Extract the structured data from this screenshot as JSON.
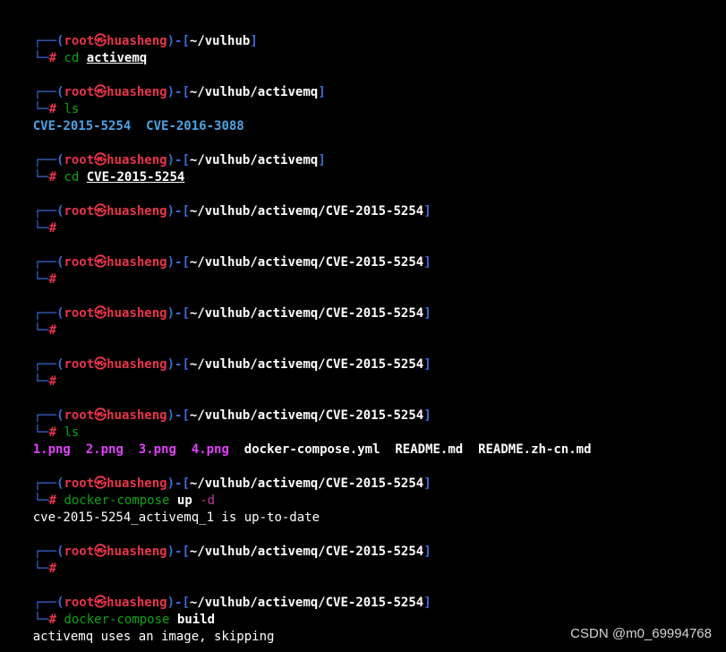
{
  "prompt": {
    "top_frame": "┌──(",
    "user": "root㉿huasheng",
    "mid_frame": ")-[",
    "end_frame": "]",
    "bottom_frame": "└─",
    "hash": "#"
  },
  "blocks": [
    {
      "path": "~/vulhub",
      "cmd": "cd",
      "arg": "activemq"
    },
    {
      "path": "~/vulhub/activemq",
      "cmd": "ls"
    },
    {
      "path": "~/vulhub/activemq",
      "cmd": "cd",
      "arg": "CVE-2015-5254"
    },
    {
      "path": "~/vulhub/activemq/CVE-2015-5254"
    },
    {
      "path": "~/vulhub/activemq/CVE-2015-5254"
    },
    {
      "path": "~/vulhub/activemq/CVE-2015-5254"
    },
    {
      "path": "~/vulhub/activemq/CVE-2015-5254"
    },
    {
      "path": "~/vulhub/activemq/CVE-2015-5254",
      "cmd": "ls"
    },
    {
      "path": "~/vulhub/activemq/CVE-2015-5254",
      "cmd": "docker-compose",
      "arg": "up",
      "flag": "-d"
    },
    {
      "path": "~/vulhub/activemq/CVE-2015-5254"
    },
    {
      "path": "~/vulhub/activemq/CVE-2015-5254",
      "cmd": "docker-compose",
      "arg": "build"
    }
  ],
  "outputs": {
    "ls_activemq": [
      "CVE-2015-5254",
      "CVE-2016-3088"
    ],
    "ls_cve_images": [
      "1.png",
      "2.png",
      "3.png",
      "4.png"
    ],
    "ls_cve_files": [
      "docker-compose.yml",
      "README.md",
      "README.zh-cn.md"
    ],
    "compose_up": "cve-2015-5254_activemq_1 is up-to-date",
    "compose_build": "activemq uses an image, skipping"
  },
  "watermark": "CSDN @m0_69994768",
  "colors": {
    "background": "#000000",
    "frame": "#3b6bd9",
    "user": "#e8344a",
    "command": "#0ea30e",
    "directory": "#4aa3e6",
    "image_file": "#e040fb",
    "flag": "#c0399a"
  }
}
